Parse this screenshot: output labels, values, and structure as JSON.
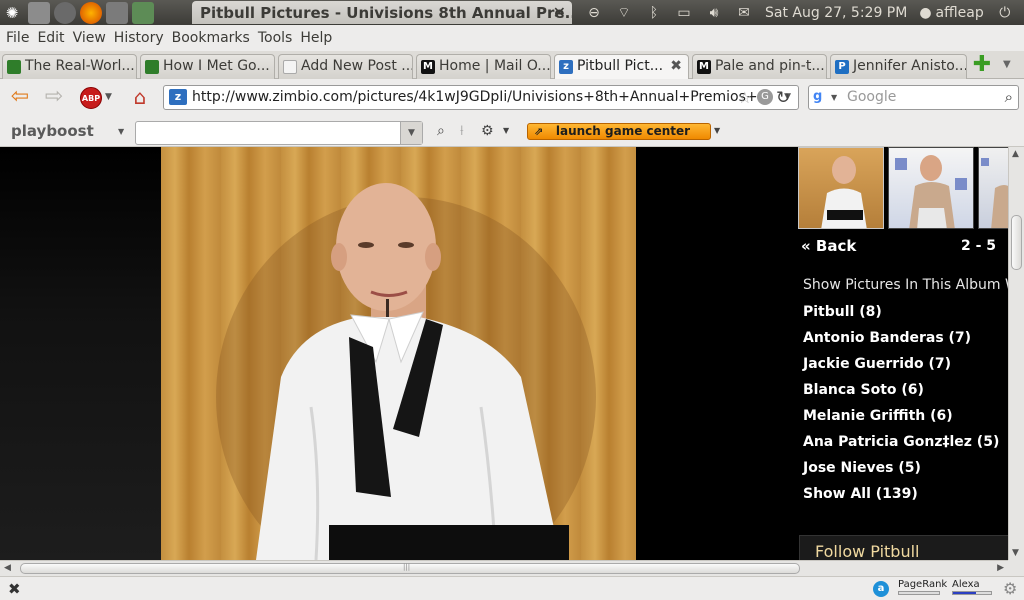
{
  "system": {
    "window_title": "Pitbull Pictures - Univisions 8th Annual Pre...",
    "datetime": "Sat Aug 27,  5:29 PM",
    "user": "affleap"
  },
  "menu": [
    "File",
    "Edit",
    "View",
    "History",
    "Bookmarks",
    "Tools",
    "Help"
  ],
  "tabs": [
    {
      "label": "The Real-Worl...",
      "icon": "leaf-icon"
    },
    {
      "label": "How I Met Go...",
      "icon": "leaf-icon"
    },
    {
      "label": "Add New Post ...",
      "icon": "page-icon"
    },
    {
      "label": "Home | Mail O...",
      "icon": "mail-online-icon"
    },
    {
      "label": "Pitbull Pict...",
      "icon": "zimbio-icon",
      "active": true
    },
    {
      "label": "Pale and pin-t...",
      "icon": "mail-online-icon"
    },
    {
      "label": "Jennifer Anisto...",
      "icon": "p-icon"
    }
  ],
  "navbar": {
    "url": "http://www.zimbio.com/pictures/4k1wJ9GDpIi/Univisions+8th+Annual+Premios+",
    "search_placeholder": "Google",
    "abp": "ABP"
  },
  "playboost": {
    "logo": "playboost",
    "launch_label": "launch game center"
  },
  "sidebar": {
    "back_label": "« Back",
    "pager": "2 - 5",
    "album_heading": "Show Pictures In This Album With:",
    "links": [
      "Pitbull (8)",
      "Antonio Banderas (7)",
      "Jackie Guerrido (7)",
      "Blanca Soto (6)",
      "Melanie Griffith (6)",
      "Ana Patricia Gonz‡lez (5)",
      "Jose Nieves (5)",
      "Show All (139)"
    ],
    "follow_label": "Follow Pitbull"
  },
  "statusbar": {
    "pagerank_label": "PageRank",
    "alexa_label": "Alexa"
  },
  "colors": {
    "game_button": "#f08900",
    "follow_text": "#f0d9a0",
    "sidebar_bg": "#000000"
  }
}
